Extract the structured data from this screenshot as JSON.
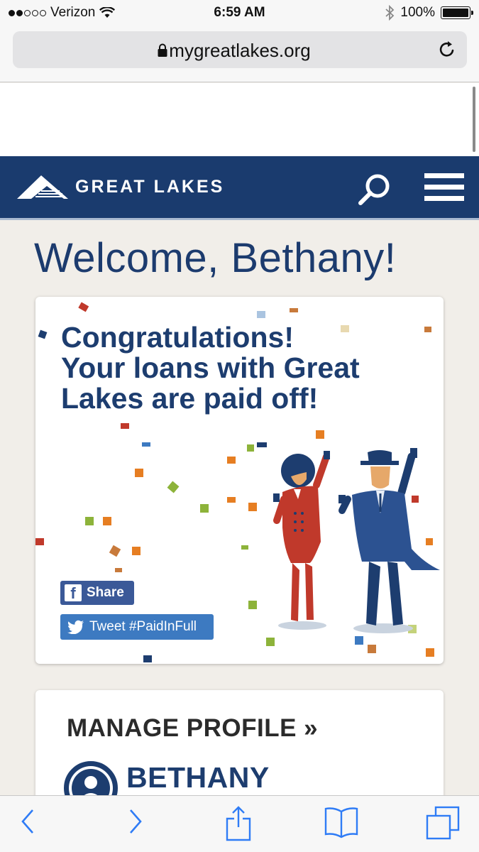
{
  "status_bar": {
    "carrier": "Verizon",
    "time": "6:59 AM",
    "battery": "100%",
    "signal_icon": "signal-dots-icon",
    "wifi_icon": "wifi-icon",
    "bluetooth_icon": "bluetooth-icon"
  },
  "browser": {
    "url": "mygreatlakes.org",
    "lock_icon": "lock-icon",
    "reload_icon": "reload-icon"
  },
  "header": {
    "logo_text": "GREAT LAKES",
    "background": "#1a3b6e"
  },
  "page": {
    "welcome": "Welcome, Bethany!",
    "congrats_line1": "Congratulations!",
    "congrats_line2": "Your loans with Great Lakes are paid off!",
    "share_label": "Share",
    "tweet_label": "Tweet #PaidInFull"
  },
  "profile": {
    "heading": "MANAGE PROFILE »",
    "name": "BETHANY"
  },
  "toolbar": {
    "items": [
      "back-icon",
      "forward-icon",
      "share-icon",
      "bookmarks-icon",
      "tabs-icon"
    ]
  },
  "colors": {
    "brand_navy": "#1a3b6e",
    "facebook": "#3b5998",
    "twitter": "#3d7ac1",
    "page_bg": "#f1eee9"
  }
}
